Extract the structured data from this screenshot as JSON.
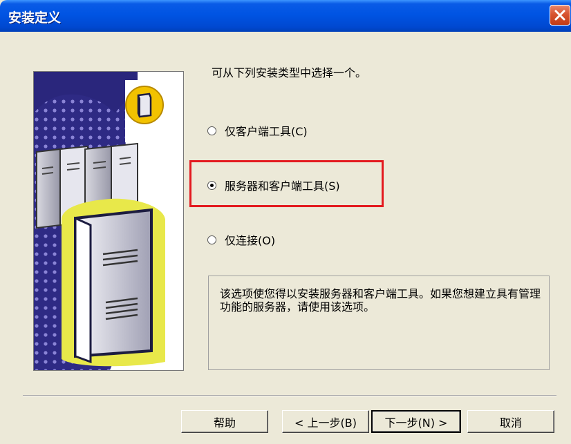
{
  "window": {
    "title": "安装定义"
  },
  "intro": "可从下列安装类型中选择一个。",
  "options": [
    {
      "label": "仅客户端工具(C)",
      "checked": false
    },
    {
      "label": "服务器和客户端工具(S)",
      "checked": true
    },
    {
      "label": "仅连接(O)",
      "checked": false
    }
  ],
  "description": "该选项使您得以安装服务器和客户端工具。如果您想建立具有管理功能的服务器，请使用该选项。",
  "buttons": {
    "help": "帮助",
    "back": "< 上一步(B)",
    "next": "下一步(N) >",
    "cancel": "取消"
  },
  "colors": {
    "titlebar": "#0054E3",
    "highlight": "#E3191E",
    "dialog_bg": "#ECE9D8"
  },
  "icons": [
    "close-icon",
    "server-icon",
    "database-icon"
  ]
}
